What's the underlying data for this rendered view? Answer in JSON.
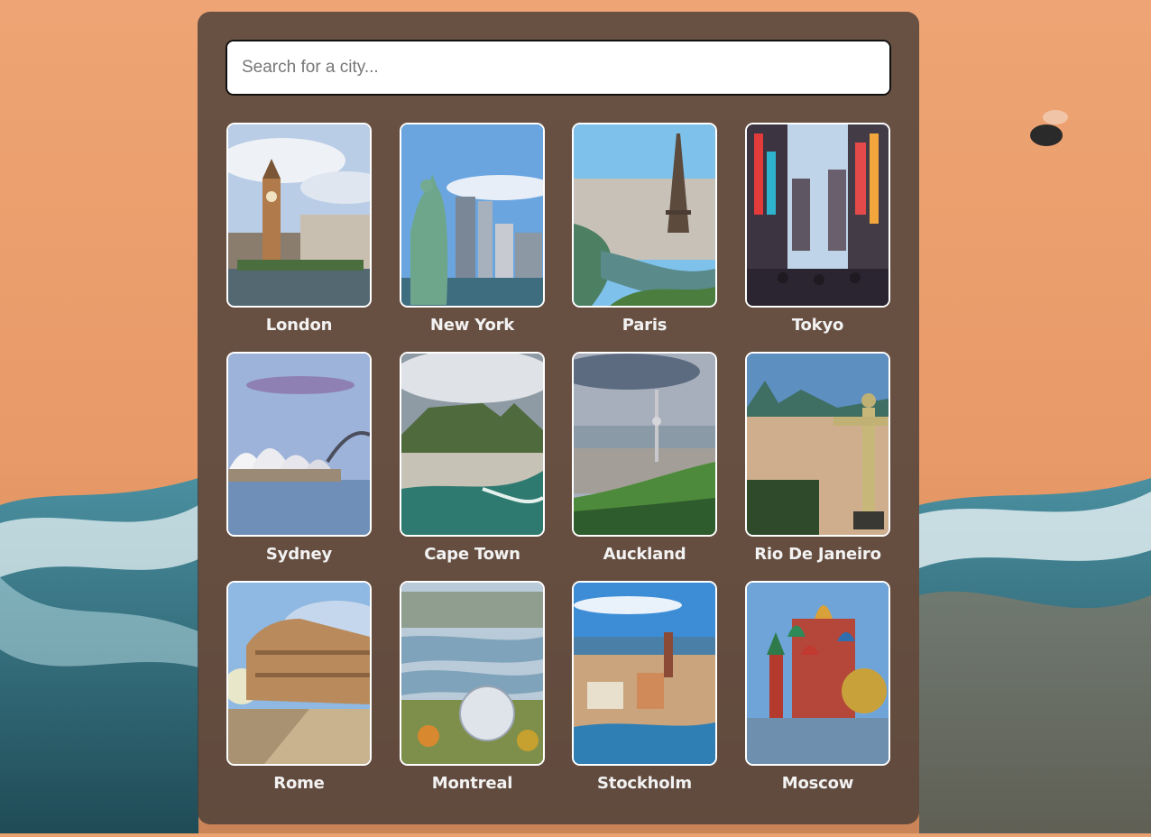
{
  "search": {
    "placeholder": "Search for a city...",
    "value": ""
  },
  "cities": [
    {
      "name": "London"
    },
    {
      "name": "New York"
    },
    {
      "name": "Paris"
    },
    {
      "name": "Tokyo"
    },
    {
      "name": "Sydney"
    },
    {
      "name": "Cape Town"
    },
    {
      "name": "Auckland"
    },
    {
      "name": "Rio De Janeiro"
    },
    {
      "name": "Rome"
    },
    {
      "name": "Montreal"
    },
    {
      "name": "Stockholm"
    },
    {
      "name": "Moscow"
    }
  ],
  "colors": {
    "panel": "#463c37",
    "accent": "#ffffff",
    "label": "#f2f2f2"
  }
}
